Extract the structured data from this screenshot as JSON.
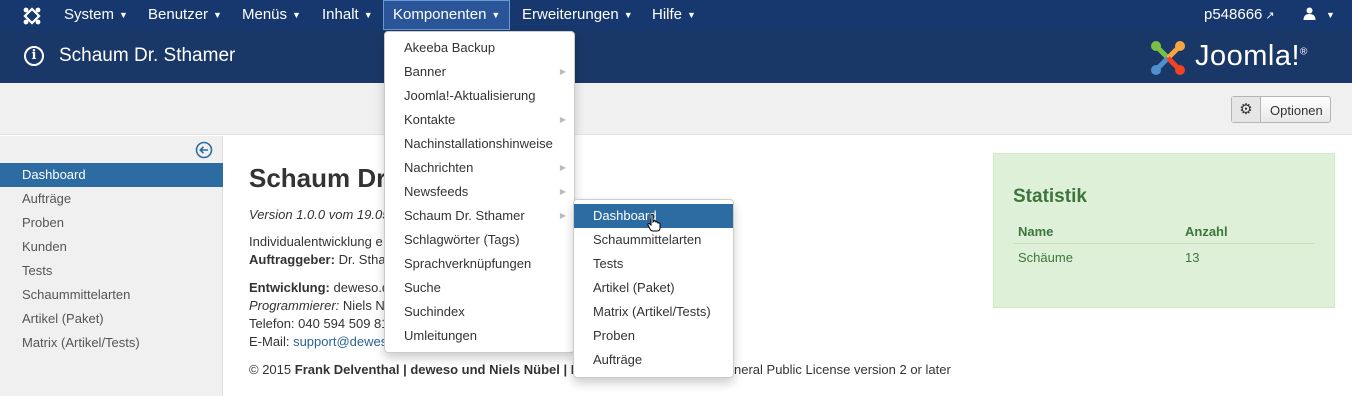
{
  "navbar": {
    "logo_icon": "joomla-logo-icon",
    "menus": [
      {
        "label": "System"
      },
      {
        "label": "Benutzer"
      },
      {
        "label": "Menüs"
      },
      {
        "label": "Inhalt"
      },
      {
        "label": "Komponenten"
      },
      {
        "label": "Erweiterungen"
      },
      {
        "label": "Hilfe"
      }
    ],
    "user_site": "p548666",
    "user_icon": "user-icon",
    "caret": "▼"
  },
  "titlebar": {
    "title": "Schaum Dr. Sthamer",
    "brand": "Joomla!",
    "brand_sup": "®"
  },
  "toolbar": {
    "options_label": "Optionen"
  },
  "sidebar": {
    "items": [
      {
        "label": "Dashboard"
      },
      {
        "label": "Aufträge"
      },
      {
        "label": "Proben"
      },
      {
        "label": "Kunden"
      },
      {
        "label": "Tests"
      },
      {
        "label": "Schaummittelarten"
      },
      {
        "label": "Artikel (Paket)"
      },
      {
        "label": "Matrix (Artikel/Tests)"
      }
    ]
  },
  "main": {
    "heading": "Schaum Dr",
    "version": "Version 1.0.0 vom 19.05",
    "line_individual": "Individualentwicklung e",
    "client_label": "Auftraggeber:",
    "client_value": "Dr. Stha",
    "dev_label": "Entwicklung:",
    "dev_value": "deweso.d",
    "programmer_label": "Programmierer:",
    "programmer_value": "Niels N",
    "phone": "Telefon: 040 594 509 81",
    "email_label": "E-Mail:",
    "email_value": "support@dewes",
    "copyright_prefix": "© 2015",
    "copyright_bold": "Frank Delventhal | deweso und Niels Nübel | I",
    "copyright_suffix": "neral Public License version 2 or later"
  },
  "stats": {
    "title": "Statistik",
    "col_name": "Name",
    "col_count": "Anzahl",
    "rows": [
      {
        "name": "Schäume",
        "count": "13"
      }
    ]
  },
  "komponenten_menu": {
    "items": [
      {
        "label": "Akeeba Backup",
        "sub": ""
      },
      {
        "label": "Banner",
        "sub": "▶"
      },
      {
        "label": "Joomla!-Aktualisierung",
        "sub": ""
      },
      {
        "label": "Kontakte",
        "sub": "▶"
      },
      {
        "label": "Nachinstallationshinweise",
        "sub": ""
      },
      {
        "label": "Nachrichten",
        "sub": "▶"
      },
      {
        "label": "Newsfeeds",
        "sub": "▶"
      },
      {
        "label": "Schaum Dr. Sthamer",
        "sub": "▶"
      },
      {
        "label": "Schlagwörter (Tags)",
        "sub": ""
      },
      {
        "label": "Sprachverknüpfungen",
        "sub": ""
      },
      {
        "label": "Suche",
        "sub": ""
      },
      {
        "label": "Suchindex",
        "sub": ""
      },
      {
        "label": "Umleitungen",
        "sub": ""
      }
    ]
  },
  "schaum_submenu": {
    "items": [
      {
        "label": "Dashboard"
      },
      {
        "label": "Schaummittelarten"
      },
      {
        "label": "Tests"
      },
      {
        "label": "Artikel (Paket)"
      },
      {
        "label": "Matrix (Artikel/Tests)"
      },
      {
        "label": "Proben"
      },
      {
        "label": "Aufträge"
      }
    ]
  },
  "colors": {
    "navbar_bg": "#17386e",
    "titlebar_bg": "#1a3867",
    "active_blue": "#2d6ca2",
    "stats_bg": "#dff0d8",
    "stats_text": "#3c763d"
  }
}
